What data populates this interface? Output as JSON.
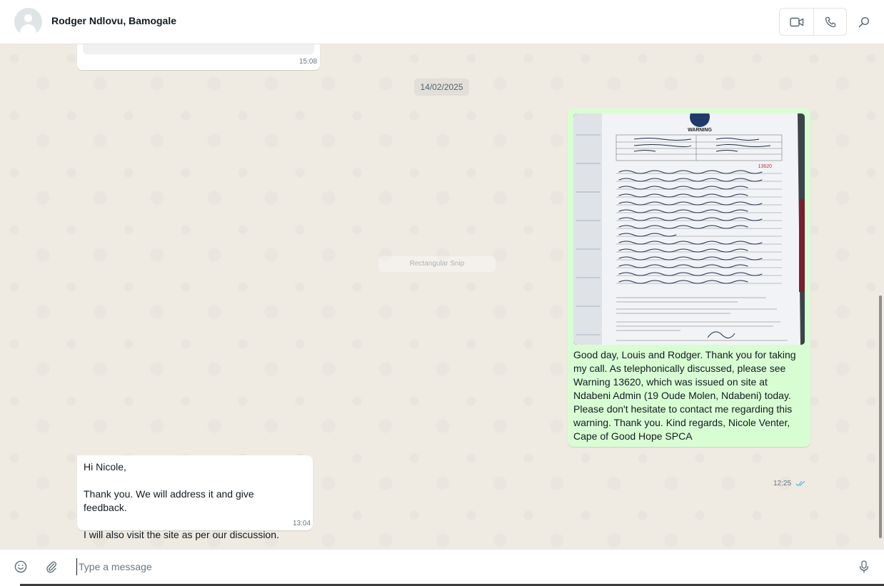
{
  "header": {
    "title": "Rodger Ndlovu, Bamogale"
  },
  "chat": {
    "top_partial_message": {
      "time": "15:08"
    },
    "date_separator": "14/02/2025",
    "faded_overlay_label": "Rectangular Snip",
    "outgoing_message": {
      "text": "Good day, Louis and Rodger. Thank you for taking my call. As telephonically discussed, please see Warning 13620, which was issued on site at Ndabeni Admin (19 Oude Molen, Ndabeni) today. Please don't hesitate to contact me regarding this warning. Thank you. Kind regards, Nicole Venter, Cape of Good Hope SPCA",
      "time": "12:25",
      "status": "read",
      "attachment": {
        "kind": "photo",
        "heading": "WARNING",
        "number": "13620"
      }
    },
    "incoming_message": {
      "text": "Hi Nicole,\n\nThank you. We will address it and give feedback.\n\nI will also visit the site as per our discussion.",
      "time": "13:04"
    }
  },
  "composer": {
    "placeholder": "Type a message"
  },
  "icons": {
    "video": "video-call-icon",
    "voice": "phone-icon",
    "search": "search-icon",
    "emoji": "emoji-icon",
    "attach": "paperclip-icon",
    "mic": "microphone-icon",
    "ticks": "double-check-icon"
  },
  "colors": {
    "outgoing_bubble": "#d9fdd3",
    "incoming_bubble": "#ffffff",
    "read_ticks": "#53bdeb",
    "chat_background": "#efeae2"
  }
}
